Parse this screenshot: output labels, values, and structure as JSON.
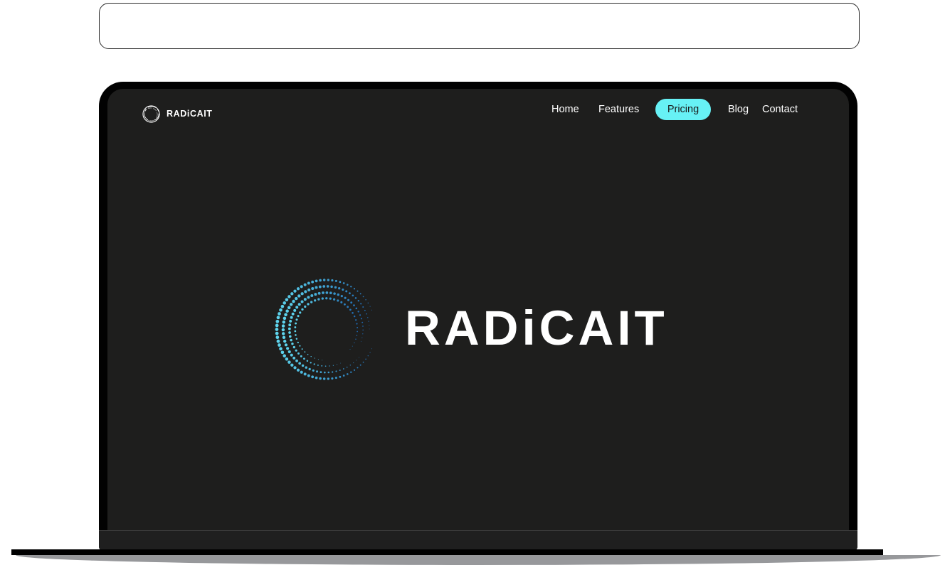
{
  "search": {
    "placeholder": ""
  },
  "nav": {
    "brand": "RADiCAIT",
    "items": [
      {
        "label": "Home",
        "active": false
      },
      {
        "label": "Features",
        "active": false
      },
      {
        "label": "Pricing",
        "active": true
      },
      {
        "label": "Blog",
        "active": false
      },
      {
        "label": "Contact",
        "active": false
      }
    ]
  },
  "hero": {
    "title": "RADiCAIT",
    "logo_icon": "dotted-ring-icon"
  },
  "colors": {
    "screen_background": "#1e1e1d",
    "active_nav_pill": "#67f1f5",
    "logo_gradient_start": "#5fd6ee",
    "logo_gradient_end": "#1e67b0"
  }
}
